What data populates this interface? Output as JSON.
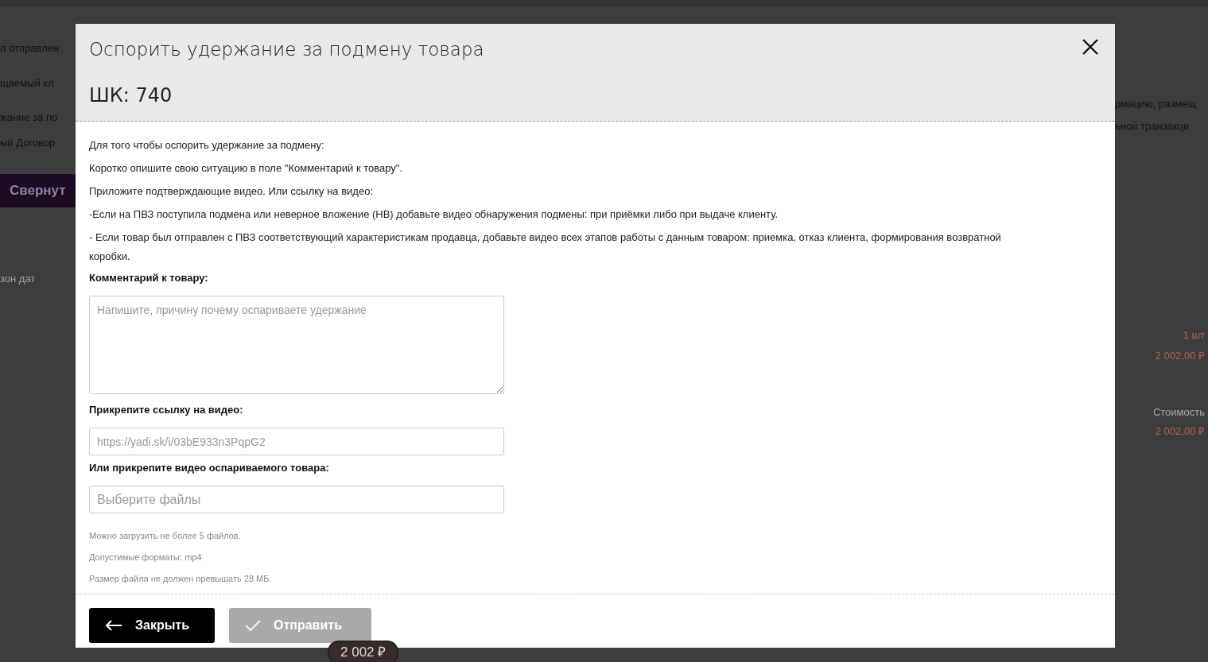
{
  "background": {
    "left_texts": [
      "л отправлен",
      "щаемый кл",
      "жание за по",
      "ый Договор"
    ],
    "collapse_button": "Свернут",
    "date_field": "зон дат",
    "right_texts": [
      "рмацию, размещ",
      "ьной транзакци"
    ],
    "quantity": "1 шт",
    "price": "2 002,00 ₽",
    "cost_label": "Стоимость",
    "cost": "2 002,00 ₽",
    "price_tag": "2 002 ₽"
  },
  "modal": {
    "title": "Оспорить удержание за подмену товара",
    "barcode": "ШК: 740",
    "instructions": [
      "Для того чтобы оспорить удержание за подмену:",
      "Коротко опишите свою ситуацию в поле \"Комментарий к товару\".",
      "Приложите подтверждающие видео. Или ссылку на видео:",
      "-Если на ПВЗ поступила подмена или неверное вложение (НВ) добавьте видео обнаружения подмены: при приёмки либо при выдаче клиенту.",
      "- Если товар был отправлен с ПВЗ соответствующий характеристикам продавца, добавьте видео всех этапов работы с данным товаром: приемка, отказ клиента, формирования возвратной коробки."
    ],
    "comment": {
      "label": "Комментарий к товару:",
      "placeholder": "Напишите, причину почему оспариваете удержание"
    },
    "link": {
      "label": "Прикрепите ссылку на видео:",
      "placeholder": "https://yadi.sk/i/03bE933n3PqpG2"
    },
    "file": {
      "label": "Или прикрепите видео оспариваемого товара:",
      "placeholder": "Выберите файлы"
    },
    "hints": [
      "Можно загрузить не более 5 файлов.",
      "Допустимые форматы: mp4",
      "Размер файла не должен превышать 28 МБ."
    ],
    "buttons": [
      {
        "kind": "back",
        "label": "Закрыть",
        "disabled": false
      },
      {
        "kind": "submit",
        "label": "Отправить",
        "disabled": true
      }
    ]
  }
}
